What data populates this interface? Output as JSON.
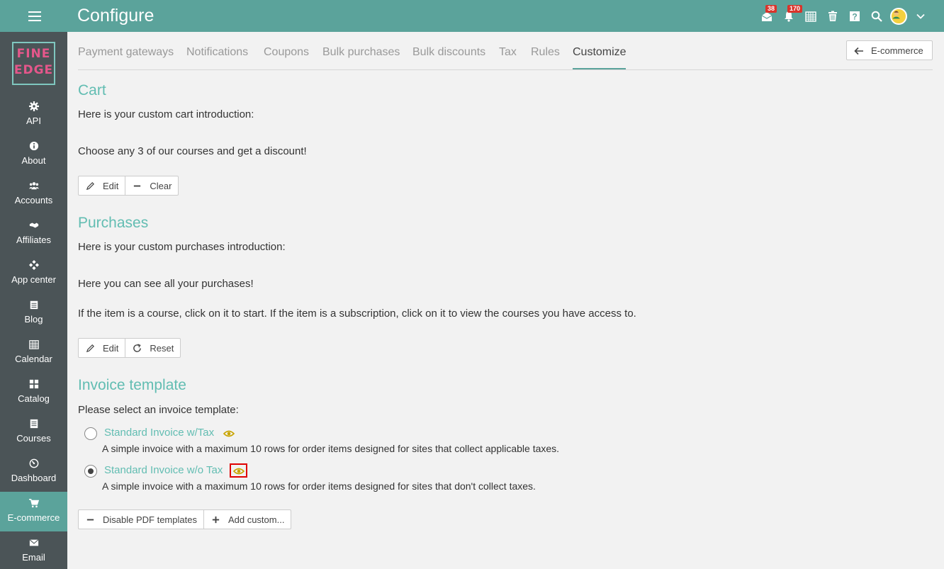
{
  "header": {
    "title": "Configure",
    "messages_badge": "38",
    "notifications_badge": "170"
  },
  "logo": {
    "line1": "FINE",
    "line2": "EDGE"
  },
  "sidebar": {
    "items": [
      {
        "label": "API",
        "icon": "gear-icon"
      },
      {
        "label": "About",
        "icon": "info-icon"
      },
      {
        "label": "Accounts",
        "icon": "users-icon"
      },
      {
        "label": "Affiliates",
        "icon": "handshake-icon"
      },
      {
        "label": "App center",
        "icon": "apps-icon"
      },
      {
        "label": "Blog",
        "icon": "blog-icon"
      },
      {
        "label": "Calendar",
        "icon": "calendar-icon"
      },
      {
        "label": "Catalog",
        "icon": "grid-icon"
      },
      {
        "label": "Courses",
        "icon": "courses-icon"
      },
      {
        "label": "Dashboard",
        "icon": "dashboard-icon"
      },
      {
        "label": "E-commerce",
        "icon": "cart-icon",
        "active": true
      },
      {
        "label": "Email",
        "icon": "envelope-icon"
      }
    ]
  },
  "tabs": [
    "Payment gateways",
    "Notifications",
    "Coupons",
    "Bulk purchases",
    "Bulk discounts",
    "Tax",
    "Rules",
    "Customize"
  ],
  "active_tab": "Customize",
  "back_button": "E-commerce",
  "cart": {
    "title": "Cart",
    "intro": "Here is your custom cart introduction:",
    "message": "Choose any 3 of our courses and get a discount!",
    "edit": "Edit",
    "clear": "Clear"
  },
  "purchases": {
    "title": "Purchases",
    "intro": "Here is your custom purchases introduction:",
    "line1": "Here you can see all your purchases!",
    "line2": "If the item is a course, click on it to start. If the item is a subscription, click on it to view the courses you have access to.",
    "edit": "Edit",
    "reset": "Reset"
  },
  "invoice": {
    "title": "Invoice template",
    "prompt": "Please select an invoice template:",
    "options": [
      {
        "label": "Standard Invoice w/Tax",
        "description": "A simple invoice with a maximum 10 rows for order items designed for sites that collect applicable taxes.",
        "checked": false
      },
      {
        "label": "Standard Invoice w/o Tax",
        "description": "A simple invoice with a maximum 10 rows for order items designed for sites that don't collect taxes.",
        "checked": true
      }
    ],
    "disable_pdf": "Disable PDF templates",
    "add_custom": "Add custom..."
  },
  "colors": {
    "primary": "#5ba39b",
    "accent_text": "#62bdb2",
    "sidebar_bg": "#4b5457",
    "badge": "#d9342b",
    "eye": "#c8a400",
    "highlight": "#e00000"
  }
}
